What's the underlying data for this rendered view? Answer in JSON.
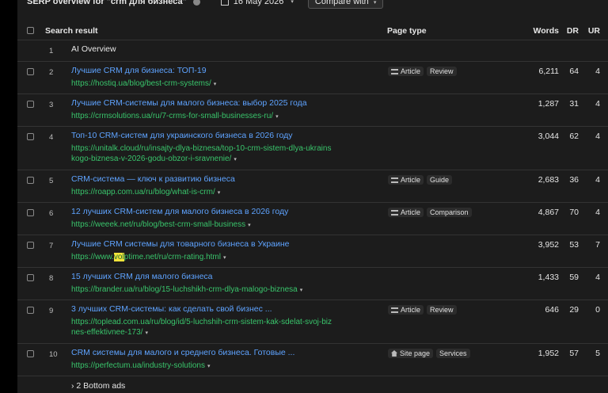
{
  "top": {
    "serp_label": "SERP overview for \"crm для бизнеса\"",
    "date": "16 May 2026",
    "compare": "Compare with"
  },
  "headers": {
    "search_result": "Search result",
    "page_type": "Page type",
    "words": "Words",
    "dr": "DR",
    "ur": "UR"
  },
  "ai_overview": {
    "num": "1",
    "label": "AI Overview"
  },
  "rows": [
    {
      "num": "2",
      "title": "Лучшие CRM для бизнеса: ТОП-19",
      "url": [
        "https://hostiq.ua/blog/best-crm-systems/"
      ],
      "tags": [
        "Article",
        "Review"
      ],
      "words": "6,211",
      "dr": "64",
      "ur": "4"
    },
    {
      "num": "3",
      "title": "Лучшие CRM-системы для малого бизнеса: выбор 2025 года",
      "url": [
        "https://crmsolutions.ua/ru/7-crms-for-small-businesses-ru/"
      ],
      "tags": [],
      "words": "1,287",
      "dr": "31",
      "ur": "4"
    },
    {
      "num": "4",
      "title": "Топ-10 CRM-систем для украинского бизнеса в 2026 году",
      "url": [
        "https://unitalk.cloud/ru/insajty-dlya-biznesa/top-10-crm-sistem-dlya-ukrains",
        "kogo-biznesa-v-2026-godu-obzor-i-sravnenie/"
      ],
      "tags": [],
      "words": "3,044",
      "dr": "62",
      "ur": "4"
    },
    {
      "num": "5",
      "title": "CRM-система — ключ к развитию бизнеса",
      "url": [
        "https://roapp.com.ua/ru/blog/what-is-crm/"
      ],
      "tags": [
        "Article",
        "Guide"
      ],
      "words": "2,683",
      "dr": "36",
      "ur": "4"
    },
    {
      "num": "6",
      "title": "12 лучших CRM-систем для малого бизнеса в 2026 году",
      "url": [
        "https://weeek.net/ru/blog/best-crm-small-business"
      ],
      "tags": [
        "Article",
        "Comparison"
      ],
      "words": "4,867",
      "dr": "70",
      "ur": "4"
    },
    {
      "num": "7",
      "title": "Лучшие CRM системы для товарного бизнеса в Украине",
      "url_parts": [
        "https://www.",
        "vol",
        "ptime.net/ru/crm-rating.html"
      ],
      "tags": [],
      "words": "3,952",
      "dr": "53",
      "ur": "7"
    },
    {
      "num": "8",
      "title": "15 лучших CRM для малого бизнеса",
      "url": [
        "https://brander.ua/ru/blog/15-luchshikh-crm-dlya-malogo-biznesa"
      ],
      "tags": [],
      "words": "1,433",
      "dr": "59",
      "ur": "4"
    },
    {
      "num": "9",
      "title": "3 лучших CRM-системы: как сделать свой бизнес ...",
      "url": [
        "https://toplead.com.ua/ru/blog/id/5-luchshih-crm-sistem-kak-sdelat-svoj-biz",
        "nes-effektivnee-173/"
      ],
      "tags": [
        "Article",
        "Review"
      ],
      "words": "646",
      "dr": "29",
      "ur": "0"
    },
    {
      "num": "10",
      "title": "CRM системы для малого и среднего бизнеса. Готовые ...",
      "url": [
        "https://perfectum.ua/industry-solutions"
      ],
      "tags": [
        "Site page",
        "Services"
      ],
      "words": "1,952",
      "dr": "57",
      "ur": "5"
    }
  ],
  "bottom_ads": "› 2 Bottom ads",
  "icons": {
    "caret": "▾",
    "info": "info-icon",
    "calendar": "calendar-icon",
    "article": "article-icon",
    "site_page": "home-icon"
  }
}
